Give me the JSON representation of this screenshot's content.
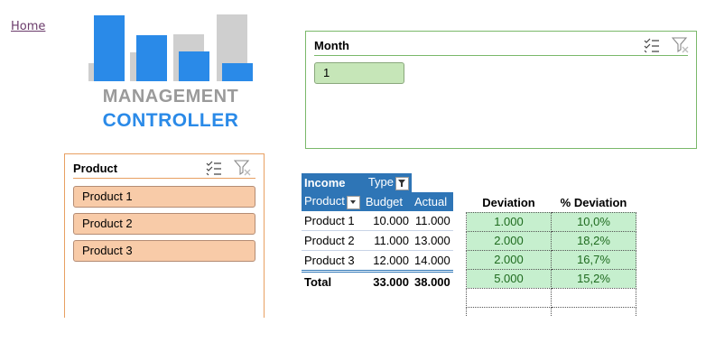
{
  "nav": {
    "home": "Home"
  },
  "logo": {
    "line1": "MANAGEMENT",
    "line2": "CONTROLLER"
  },
  "colors": {
    "accent_blue": "#2a8ae8",
    "logo_gray": "#cfcfcf",
    "pivot_header": "#2e75b6",
    "deviation_fill": "#c6efce",
    "deviation_text": "#1f6b1f"
  },
  "month_slicer": {
    "title": "Month",
    "items": [
      "1"
    ],
    "icons": [
      "multi-select-icon",
      "clear-filter-icon"
    ]
  },
  "product_slicer": {
    "title": "Product",
    "items": [
      "Product 1",
      "Product 2",
      "Product 3"
    ],
    "icons": [
      "multi-select-icon",
      "clear-filter-icon"
    ]
  },
  "pivot": {
    "header_row1": {
      "income": "Income",
      "type": "Type"
    },
    "header_row2": {
      "product": "Product",
      "budget": "Budget",
      "actual": "Actual"
    },
    "rows": [
      {
        "product": "Product 1",
        "budget": "10.000",
        "actual": "11.000"
      },
      {
        "product": "Product 2",
        "budget": "11.000",
        "actual": "13.000"
      },
      {
        "product": "Product 3",
        "budget": "12.000",
        "actual": "14.000"
      }
    ],
    "total": {
      "label": "Total",
      "budget": "33.000",
      "actual": "38.000"
    }
  },
  "deviation": {
    "header": "Deviation",
    "pct_header": "% Deviation",
    "rows": [
      {
        "dev": "1.000",
        "pct": "10,0%"
      },
      {
        "dev": "2.000",
        "pct": "18,2%"
      },
      {
        "dev": "2.000",
        "pct": "16,7%"
      },
      {
        "dev": "5.000",
        "pct": "15,2%"
      }
    ]
  }
}
